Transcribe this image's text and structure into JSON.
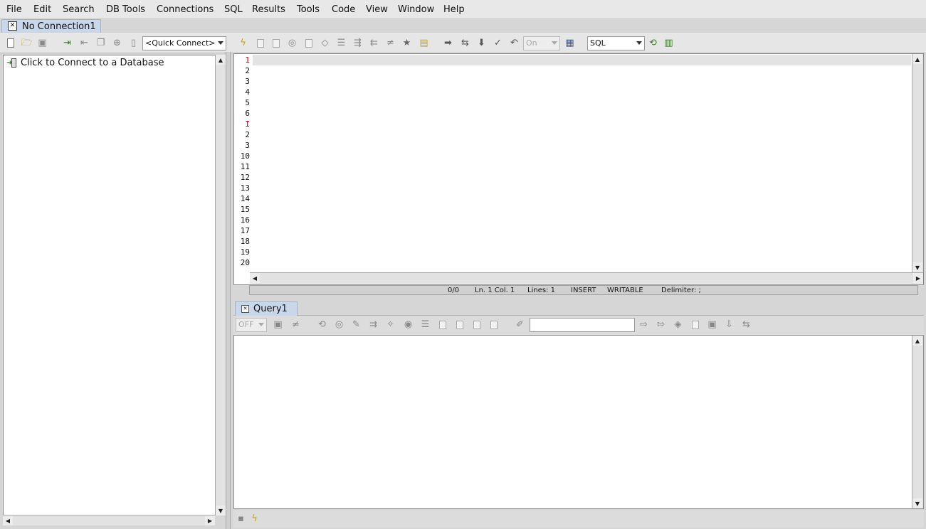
{
  "menu": [
    "File",
    "Edit",
    "Search",
    "DB Tools",
    "Connections",
    "SQL",
    "Results",
    "Tools",
    "Code",
    "View",
    "Window",
    "Help"
  ],
  "connection_tab": {
    "label": "No Connection1"
  },
  "toolbar": {
    "quick_connect": "<Quick Connect>",
    "autocommit": "On",
    "language": "SQL"
  },
  "tree": {
    "connect_label": "Click to Connect to a Database"
  },
  "editor": {
    "line_numbers": [
      "1",
      "2",
      "3",
      "4",
      "5",
      "6",
      "I",
      "2",
      "3",
      "10",
      "11",
      "12",
      "13",
      "14",
      "15",
      "16",
      "17",
      "18",
      "19",
      "20"
    ],
    "current_line_color": "#cc0000"
  },
  "status": {
    "pos": "0/0",
    "cursor": "Ln. 1 Col. 1",
    "lines": "Lines: 1",
    "mode": "INSERT",
    "access": "WRITABLE",
    "delimiter": "Delimiter: ;"
  },
  "query_tab": {
    "label": "Query1",
    "toggle": "OFF"
  },
  "icons": {
    "new": "new-file-icon",
    "open": "open-folder-icon",
    "save": "save-icon",
    "connect": "connect-icon",
    "run": "execute-icon",
    "favorite": "star-icon"
  }
}
